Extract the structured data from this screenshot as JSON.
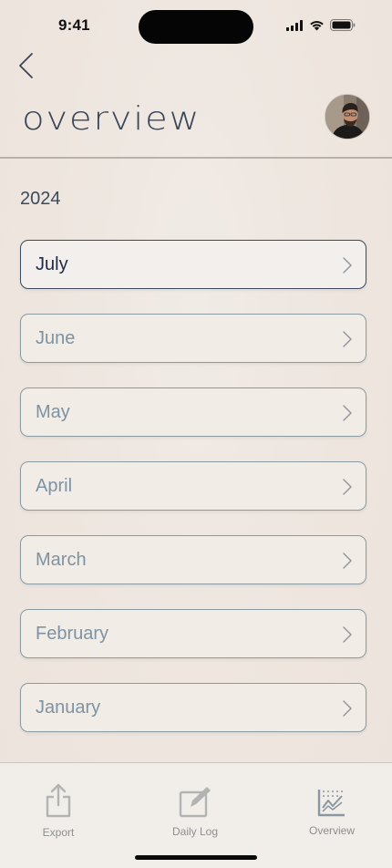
{
  "status_bar": {
    "time": "9:41"
  },
  "header": {
    "title": "overview"
  },
  "year": "2024",
  "months": [
    {
      "label": "July",
      "active": true
    },
    {
      "label": "June",
      "active": false
    },
    {
      "label": "May",
      "active": false
    },
    {
      "label": "April",
      "active": false
    },
    {
      "label": "March",
      "active": false
    },
    {
      "label": "February",
      "active": false
    },
    {
      "label": "January",
      "active": false
    }
  ],
  "tab_bar": {
    "export_label": "Export",
    "daily_log_label": "Daily Log",
    "overview_label": "Overview"
  },
  "colors": {
    "background": "#ede5de",
    "active_border": "#3b4a5c",
    "inactive_text": "#7d93a3",
    "active_text": "#1f2a44"
  }
}
